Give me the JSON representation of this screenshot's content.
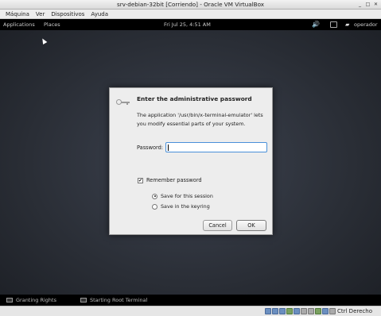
{
  "window": {
    "title": "srv-debian-32bit [Corriendo] - Oracle VM VirtualBox",
    "buttons": {
      "minimize": "_",
      "maximize": "□",
      "close": "✕"
    }
  },
  "menubar": {
    "items": [
      "Máquina",
      "Ver",
      "Dispositivos",
      "Ayuda"
    ]
  },
  "gnome_topbar": {
    "applications": "Applications",
    "places": "Places",
    "clock": "Fri Jul 25,  4:51 AM",
    "volume_icon": "volume-icon",
    "user": "operador"
  },
  "dialog": {
    "title": "Enter the administrative password",
    "message": "The application '/usr/bin/x-terminal-emulator' lets you modify essential parts of your system.",
    "password_label": "Password:",
    "password_value": "",
    "remember_label": "Remember password",
    "remember_checked": true,
    "options": [
      {
        "label": "Save for this session",
        "selected": true
      },
      {
        "label": "Save in the keyring",
        "selected": false
      }
    ],
    "cancel_label": "Cancel",
    "ok_label": "OK"
  },
  "taskbar": {
    "items": [
      {
        "label": "Granting Rights"
      },
      {
        "label": "Starting Root Terminal"
      }
    ]
  },
  "statusbar": {
    "host_key": "Ctrl Derecho"
  }
}
